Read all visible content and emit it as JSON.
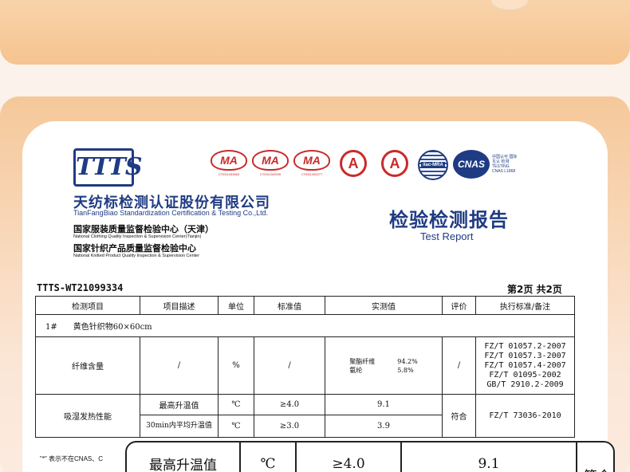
{
  "logo": {
    "text": "TTTS"
  },
  "company": {
    "name_cn": "天纺标检测认证股份有限公司",
    "name_en": "TianFangBiao Standardization Certification & Testing Co.,Ltd.",
    "center1_cn": "国家服装质量监督检验中心（天津）",
    "center1_en": "National Clothing Quality Inspection & Supervision Center(Tianjin)",
    "center2_cn": "国家针织产品质量监督检验中心",
    "center2_en": "National Knitted Product Quality Inspection & Supervision Center"
  },
  "marks": {
    "ma_label": "MA",
    "ma_numbers": [
      "170011263663",
      "170011263026",
      "170011263277"
    ],
    "cal_label": "A",
    "ilac_label": "ilac-MRA",
    "cnas_label": "CNAS",
    "cnas_side": "中国认可 国际互认 检测 TESTING CNAS L1868"
  },
  "report": {
    "title_cn": "检验检测报告",
    "title_en": "Test Report",
    "number": "TTTS-WT21099334",
    "page": "第2页 共2页"
  },
  "table": {
    "headers": [
      "检测项目",
      "项目描述",
      "单位",
      "标准值",
      "实测值",
      "评价",
      "执行标准/备注"
    ],
    "sample_row": "1#　　黄色针织物60×60cm",
    "fiber": {
      "item": "纤维含量",
      "desc": "/",
      "unit": "%",
      "standard": "/",
      "fibers": [
        "聚酯纤维",
        "氨纶"
      ],
      "values": [
        "94.2%",
        "5.8%"
      ],
      "eval": "/",
      "refs": [
        "FZ/T 01057.2-2007",
        "FZ/T 01057.3-2007",
        "FZ/T 01057.4-2007",
        "FZ/T 01095-2002",
        "GB/T 2910.2-2009"
      ]
    },
    "heat": {
      "item": "吸湿发热性能",
      "eval": "符合",
      "ref": "FZ/T 73036-2010",
      "rows": [
        {
          "desc": "最高升温值",
          "unit": "℃",
          "standard": "≥4.0",
          "value": "9.1"
        },
        {
          "desc": "30min内平均升温值",
          "unit": "℃",
          "standard": "≥3.0",
          "value": "3.9"
        }
      ]
    }
  },
  "footnote": "\"*\" 表示不在CNAS、C",
  "zoom": {
    "desc": "最高升温值",
    "unit": "℃",
    "standard": "≥4.0",
    "value": "9.1",
    "eval_partial": "符合"
  }
}
